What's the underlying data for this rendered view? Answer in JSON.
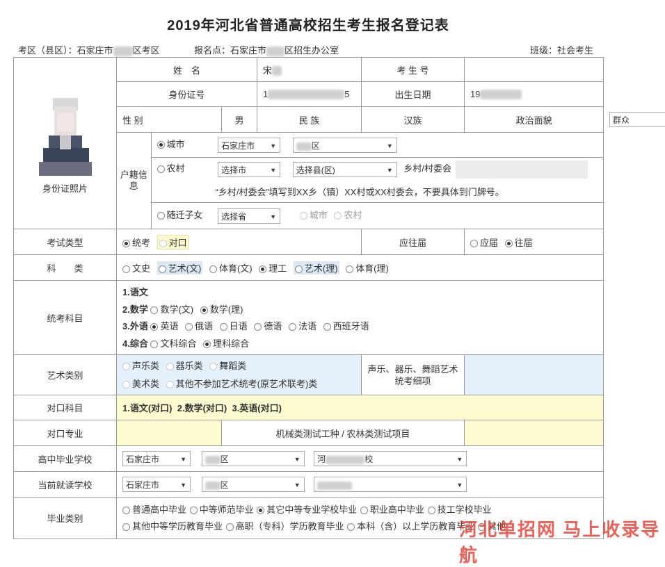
{
  "title": "2019年河北省普通高校招生考生报名登记表",
  "meta": {
    "exam_area_prefix": "考区（县区）：石家庄市",
    "exam_area_suffix": "区考区",
    "reg_point_prefix": "报名点：石家庄市",
    "reg_point_suffix": "区招生办公室",
    "class": "班级：社会考生"
  },
  "labels": {
    "name": "姓　名",
    "candidate_no": "考 生 号",
    "id_number": "身份证号",
    "birth_date": "出生日期",
    "gender": "性 别",
    "ethnicity": "民 族",
    "political": "政治面貌",
    "hukou": "户籍信息",
    "photo": "身份证照片",
    "exam_type": "考试类型",
    "graduation": "应往届",
    "category": "科　　类",
    "subjects": "统考科目",
    "art_type": "艺术类别",
    "art_detail": "声乐、器乐、舞蹈艺术统考细项",
    "vocational_subjects": "对口科目",
    "vocational_major": "对口专业",
    "machinery_test": "机械类测试工种 / 农林类测试项目",
    "high_school": "高中毕业学校",
    "current_school": "当前就读学校",
    "grad_type": "毕业类别"
  },
  "values": {
    "name": "宋",
    "id_number_start": "1",
    "id_number_end": "5",
    "birth_date": "19",
    "gender": "男",
    "ethnicity": "汉族",
    "political": "群众"
  },
  "hukou": {
    "city_label": "城市",
    "city_select": "石家庄市",
    "district_select": "区",
    "rural_label": "农村",
    "rural_city_select": "选择市",
    "rural_county_select": "选择县(区)",
    "village_label": "乡村/村委会",
    "note": "“乡村/村委会”填写到XX乡（镇）XX村或XX村委会，不要具体到门牌号。",
    "migrant_label": "随迁子女",
    "migrant_province": "选择省",
    "migrant_city": "城市",
    "migrant_rural": "农村"
  },
  "exam_type": {
    "tongkao": "统考",
    "duikou": "对口"
  },
  "graduation": {
    "current": "应届",
    "past": "往届"
  },
  "categories": [
    "文史",
    "艺术(文)",
    "体育(文)",
    "理工",
    "艺术(理)",
    "体育(理)"
  ],
  "subjects": {
    "chinese": "1.语文",
    "math": "2.数学",
    "math_opts": [
      "数学(文)",
      "数学(理)"
    ],
    "foreign": "3.外语",
    "foreign_opts": [
      "英语",
      "俄语",
      "日语",
      "德语",
      "法语",
      "西班牙语"
    ],
    "comprehensive": "4.综合",
    "comp_opts": [
      "文科综合",
      "理科综合"
    ]
  },
  "art_types": [
    "声乐类",
    "器乐类",
    "舞蹈类",
    "美术类",
    "其他不参加艺术统考(原艺术联考)类"
  ],
  "vocational_subjects_text": "1.语文(对口)  2.数学(对口)  3.英语(对口)",
  "schools": {
    "hs_city": "石家庄市",
    "hs_district": "区",
    "hs_school_prefix": "河",
    "hs_school_suffix": "校",
    "cur_city": "石家庄市",
    "cur_district": "区"
  },
  "grad_types": [
    "普通高中毕业",
    "中等师范毕业",
    "其它中等专业学校毕业",
    "职业高中毕业",
    "技工学校毕业",
    "其他中等学历教育毕业",
    "高职（专科）学历教育毕业",
    "本科（含）以上学历教育毕业",
    "其他"
  ],
  "watermark": "河北单招网 马上收录导航",
  "colors": {
    "yellow": "#fdfbd0",
    "blue": "#e4f0fb",
    "watermark": "#e63b2e"
  }
}
